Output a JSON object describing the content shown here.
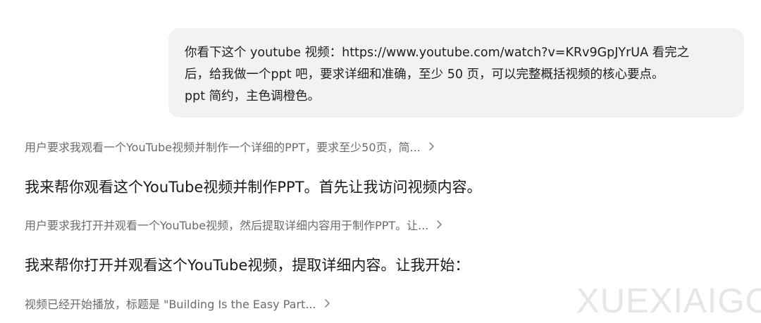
{
  "conversation": {
    "user_message": "你看下这个 youtube 视频：https://www.youtube.com/watch?v=KRv9GpJYrUA 看完之\n后，给我做一个ppt 吧，要求详细和准确，至少 50 页，可以完整概括视频的核心要点。\nppt 简约，主色调橙色。",
    "steps": [
      {
        "kind": "thinking",
        "text": "用户要求我观看一个YouTube视频并制作一个详细的PPT，要求至少50页，简...",
        "icon": "chevron-right-icon"
      },
      {
        "kind": "reply",
        "text": "我来帮你观看这个YouTube视频并制作PPT。首先让我访问视频内容。"
      },
      {
        "kind": "thinking",
        "text": "用户要求我打开并观看一个YouTube视频，然后提取详细内容用于制作PPT。让...",
        "icon": "chevron-right-icon"
      },
      {
        "kind": "reply",
        "text": "我来帮你打开并观看这个YouTube视频，提取详细内容。让我开始："
      },
      {
        "kind": "thinking",
        "text": "视频已经开始播放，标题是 \"Building Is the Easy Part...",
        "icon": "chevron-right-icon"
      }
    ]
  },
  "watermark": "XUEXIAIGC",
  "colors": {
    "bubble_bg": "#f2f2f4",
    "thinking_text": "#6b6b6b",
    "reply_text": "#1a1a1a",
    "watermark": "#e6e6e6"
  }
}
